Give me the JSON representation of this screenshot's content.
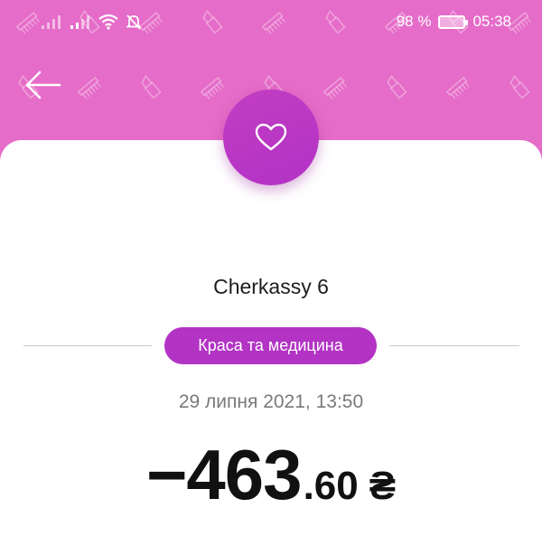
{
  "status_bar": {
    "battery_percent": "98 %",
    "time": "05:38",
    "icons": [
      "signal-icon",
      "signal-icon",
      "wifi-icon",
      "bell-off-icon",
      "battery-icon"
    ]
  },
  "header": {
    "back_icon": "arrow-left-icon",
    "background_color": "#e56cc8"
  },
  "transaction": {
    "category_icon": "heart-icon",
    "category_color": "#b233c4",
    "merchant": "Cherkassy 6",
    "category": "Краса та медицина",
    "datetime": "29 липня 2021, 13:50",
    "amount_main": "−463",
    "amount_cents": ".60",
    "currency": "₴"
  }
}
